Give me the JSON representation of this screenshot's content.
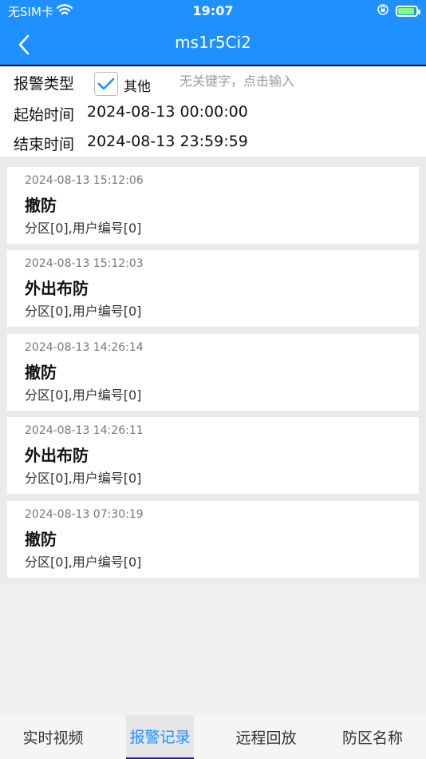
{
  "status_bar": {
    "carrier": "无SIM卡",
    "time": "19:07",
    "wifi_icon": "wifi-icon",
    "lock_icon": "orientation-lock-icon",
    "battery_icon": "battery-charging-icon"
  },
  "nav": {
    "title": "ms1r5Ci2",
    "back_icon": "chevron-left-icon"
  },
  "filter": {
    "alarm_type_label": "报警类型",
    "checkbox_label": "其他",
    "checkbox_checked": true,
    "keyword_placeholder": "无关键字，点击输入",
    "start_label": "起始时间",
    "start_value": "2024-08-13 00:00:00",
    "end_label": "结束时间",
    "end_value": "2024-08-13 23:59:59"
  },
  "records": [
    {
      "time": "2024-08-13 15:12:06",
      "title": "撤防",
      "detail": "分区[0],用户编号[0]"
    },
    {
      "time": "2024-08-13 15:12:03",
      "title": "外出布防",
      "detail": "分区[0],用户编号[0]"
    },
    {
      "time": "2024-08-13 14:26:14",
      "title": "撤防",
      "detail": "分区[0],用户编号[0]"
    },
    {
      "time": "2024-08-13 14:26:11",
      "title": "外出布防",
      "detail": "分区[0],用户编号[0]"
    },
    {
      "time": "2024-08-13 07:30:19",
      "title": "撤防",
      "detail": "分区[0],用户编号[0]"
    }
  ],
  "tabs": [
    {
      "label": "实时视频"
    },
    {
      "label": "报警记录"
    },
    {
      "label": "远程回放"
    },
    {
      "label": "防区名称"
    }
  ],
  "colors": {
    "brand": "#1e90ff",
    "active_tab_text": "#1e90ff"
  }
}
